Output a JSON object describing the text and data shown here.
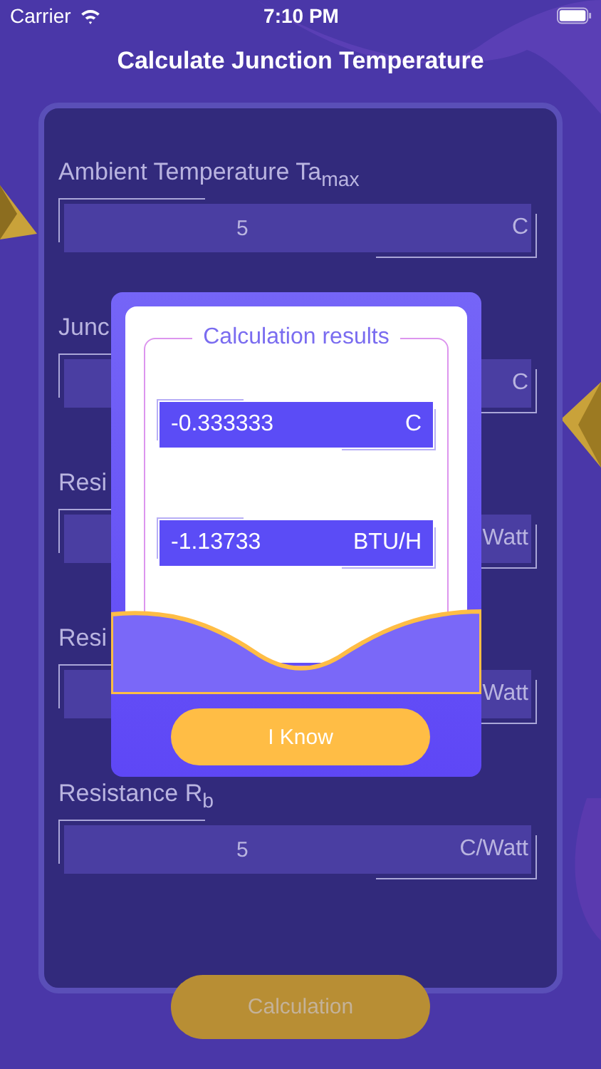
{
  "status_bar": {
    "carrier": "Carrier",
    "time": "7:10 PM"
  },
  "title": "Calculate Junction Temperature",
  "fields": [
    {
      "label": "Ambient Temperature Ta$_{max}$",
      "value": "5",
      "unit": "C"
    },
    {
      "label": "Junc",
      "unit": "C"
    },
    {
      "label": "Resi",
      "unit": "Watt"
    },
    {
      "label": "Resi",
      "unit": "Watt"
    },
    {
      "label": "Resistance R$_{b}$",
      "value": "5",
      "unit": "C/Watt"
    }
  ],
  "calculate_button": "Calculation",
  "dialog": {
    "title": "Calculation results",
    "results": [
      {
        "value": "-0.333333",
        "unit": "C"
      },
      {
        "value": "-1.13733",
        "unit": "BTU/H"
      }
    ],
    "button": "I Know"
  }
}
